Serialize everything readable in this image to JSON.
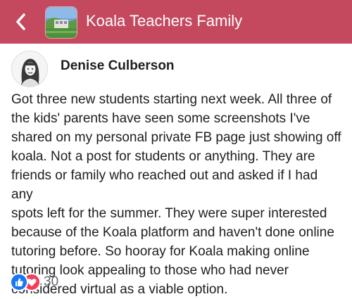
{
  "header": {
    "back_icon": "chevron-left-icon",
    "group_title": "Koala Teachers Family",
    "background_color": "#c5495e"
  },
  "post": {
    "author_name": "Denise Culberson",
    "body": "Got three new students starting next week. All three of\nthe kids' parents have seen some screenshots I've\nshared on my personal private FB page just showing off\nkoala. Not a post for students or anything. They are\nfriends or family who reached out and asked if I had any\nspots left for the summer. They were super interested\nbecause of the Koala platform and haven't done online\ntutoring before. So hooray for  Koala making online\ntutoring look appealing to those who had never\nconsidered virtual as a viable option.",
    "reactions": {
      "icons": [
        "like-icon",
        "love-icon"
      ],
      "count": "30"
    }
  }
}
